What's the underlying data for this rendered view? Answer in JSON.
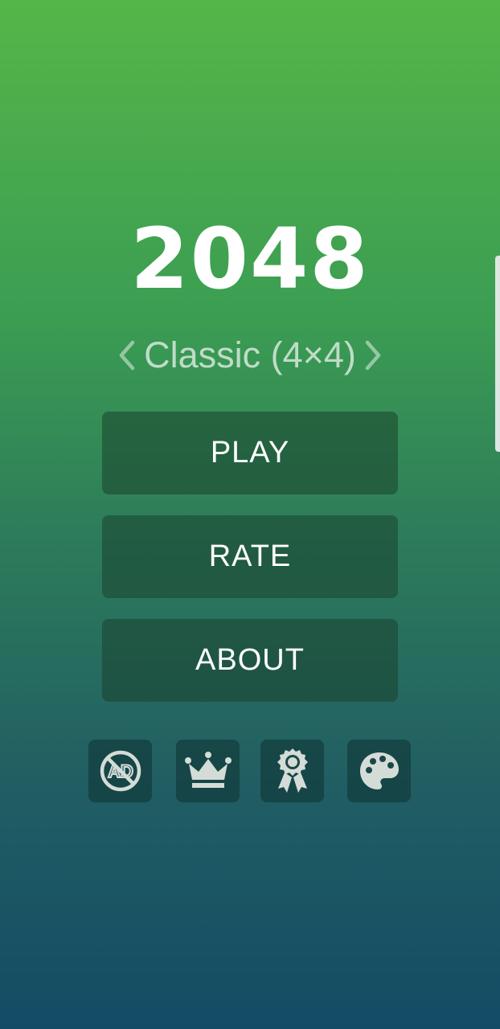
{
  "game": {
    "title": "2048",
    "mode": "Classic (4×4)"
  },
  "menu": {
    "play_label": "PLAY",
    "rate_label": "RATE",
    "about_label": "ABOUT"
  },
  "toolbar": {
    "icons": [
      "no-ads-icon",
      "crown-icon",
      "award-ribbon-icon",
      "palette-icon"
    ],
    "no_ads_text": "AD"
  },
  "colors": {
    "gradient_top": "#54b648",
    "gradient_bottom": "#134b65",
    "icon_color": "#d4dcd8"
  }
}
